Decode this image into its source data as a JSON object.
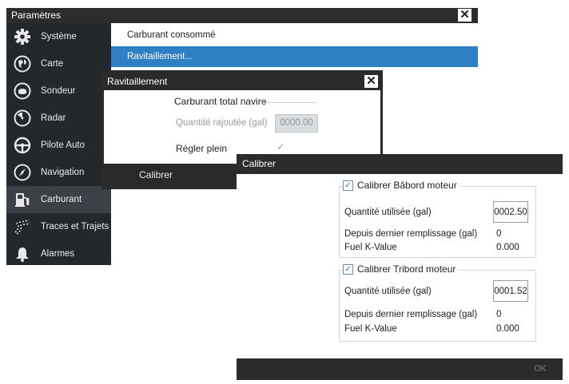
{
  "settings": {
    "title": "Paramètres",
    "close": "✕",
    "sidebar": [
      {
        "label": "Système",
        "icon": "gear-icon"
      },
      {
        "label": "Carte",
        "icon": "chart-globe-icon"
      },
      {
        "label": "Sondeur",
        "icon": "sonar-icon"
      },
      {
        "label": "Radar",
        "icon": "radar-icon"
      },
      {
        "label": "Pilote Auto",
        "icon": "steering-wheel-icon"
      },
      {
        "label": "Navigation",
        "icon": "compass-icon"
      },
      {
        "label": "Carburant",
        "icon": "fuel-pump-icon"
      },
      {
        "label": "Traces et Trajets",
        "icon": "tracks-icon"
      },
      {
        "label": "Alarmes",
        "icon": "bell-icon"
      }
    ],
    "selected_index": 6,
    "main_items": [
      "Carburant consommé",
      "Ravitaillement..."
    ]
  },
  "ravitaillement": {
    "title": "Ravitaillement",
    "close": "✕",
    "group_title": "Carburant total navire",
    "qty_label": "Quantité rajoutée (gal)",
    "qty_value": "0000.00",
    "fill_label": "Régler plein",
    "fill_checked_glyph": "✓",
    "calibrate_button": "Calibrer"
  },
  "calibrer": {
    "title": "Calibrer",
    "check_glyph": "✓",
    "ok_button": "OK",
    "port": {
      "title": "Calibrer Bâbord moteur",
      "used_label": "Quantité utilisée (gal)",
      "used_value": "0002.50",
      "since_label": "Depuis dernier remplissage (gal)",
      "since_value": "0",
      "k_label": "Fuel K-Value",
      "k_value": "0.000"
    },
    "starboard": {
      "title": "Calibrer Tribord moteur",
      "used_label": "Quantité utilisée (gal)",
      "used_value": "0001.52",
      "since_label": "Depuis dernier remplissage (gal)",
      "since_value": "0",
      "k_label": "Fuel K-Value",
      "k_value": "0.000"
    }
  }
}
